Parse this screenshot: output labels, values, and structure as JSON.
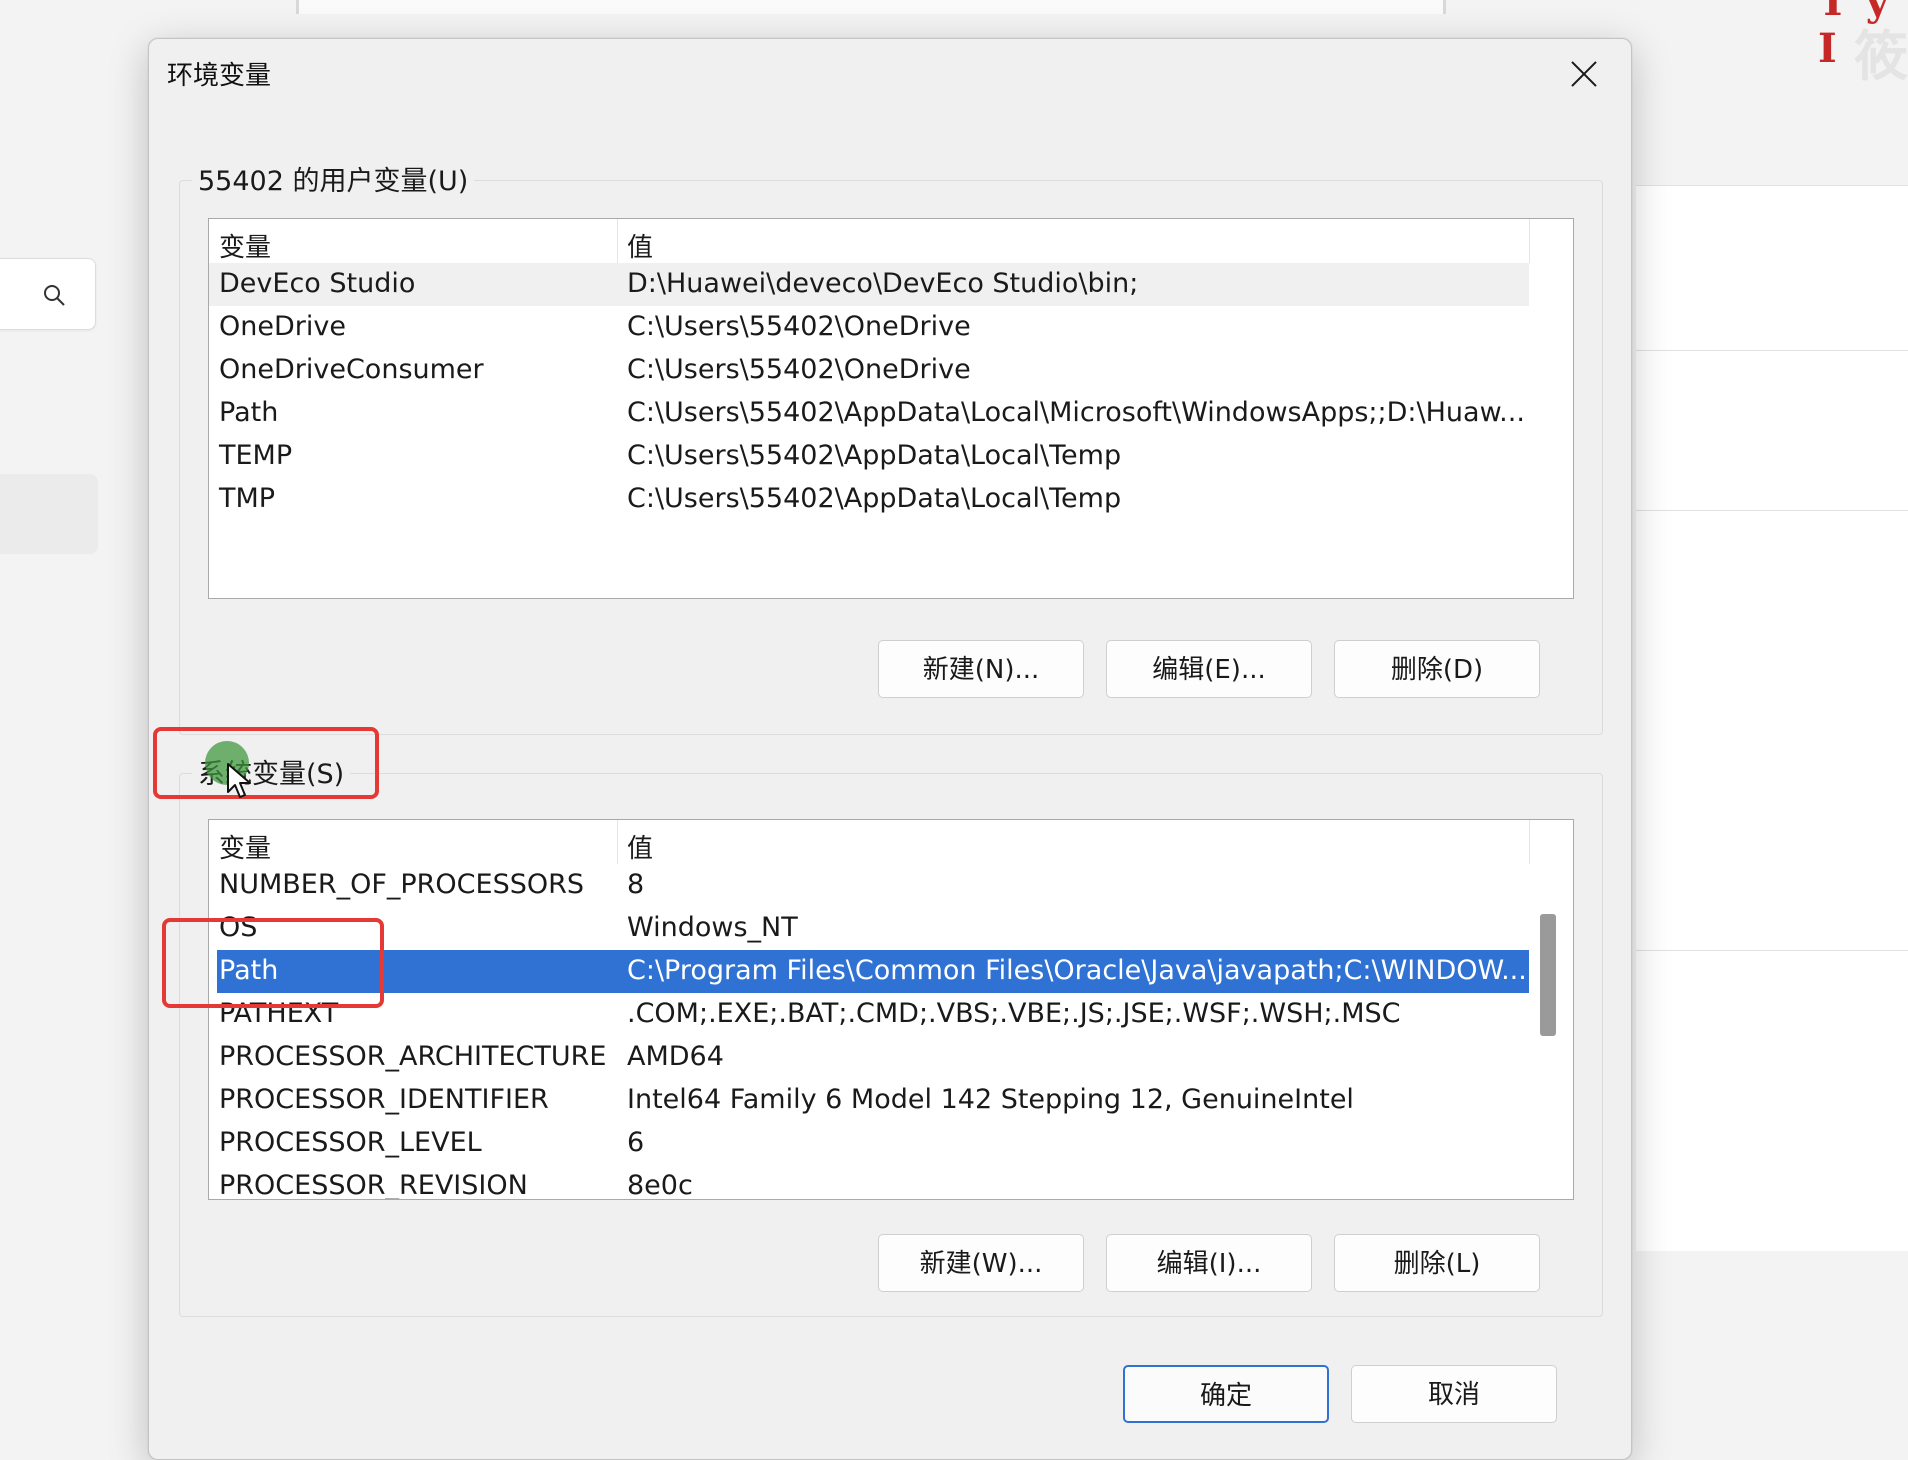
{
  "dialog": {
    "title": "环境变量",
    "user_section": {
      "legend": "55402 的用户变量(U)",
      "columns": [
        "变量",
        "值"
      ],
      "rows": [
        {
          "name": "DevEco Studio",
          "value": "D:\\Huawei\\deveco\\DevEco Studio\\bin;"
        },
        {
          "name": "OneDrive",
          "value": "C:\\Users\\55402\\OneDrive"
        },
        {
          "name": "OneDriveConsumer",
          "value": "C:\\Users\\55402\\OneDrive"
        },
        {
          "name": "Path",
          "value": "C:\\Users\\55402\\AppData\\Local\\Microsoft\\WindowsApps;;D:\\Huaw..."
        },
        {
          "name": "TEMP",
          "value": "C:\\Users\\55402\\AppData\\Local\\Temp"
        },
        {
          "name": "TMP",
          "value": "C:\\Users\\55402\\AppData\\Local\\Temp"
        }
      ],
      "buttons": {
        "new": "新建(N)...",
        "edit": "编辑(E)...",
        "delete": "删除(D)"
      }
    },
    "system_section": {
      "legend": "系统变量(S)",
      "columns": [
        "变量",
        "值"
      ],
      "rows": [
        {
          "name": "NUMBER_OF_PROCESSORS",
          "value": "8"
        },
        {
          "name": "OS",
          "value": "Windows_NT"
        },
        {
          "name": "Path",
          "value": "C:\\Program Files\\Common Files\\Oracle\\Java\\javapath;C:\\WINDOW..."
        },
        {
          "name": "PATHEXT",
          "value": ".COM;.EXE;.BAT;.CMD;.VBS;.VBE;.JS;.JSE;.WSF;.WSH;.MSC"
        },
        {
          "name": "PROCESSOR_ARCHITECTURE",
          "value": "AMD64"
        },
        {
          "name": "PROCESSOR_IDENTIFIER",
          "value": "Intel64 Family 6 Model 142 Stepping 12, GenuineIntel"
        },
        {
          "name": "PROCESSOR_LEVEL",
          "value": "6"
        },
        {
          "name": "PROCESSOR_REVISION",
          "value": "8e0c"
        }
      ],
      "selected_row": "Path",
      "buttons": {
        "new": "新建(W)...",
        "edit": "编辑(I)...",
        "delete": "删除(L)"
      }
    },
    "footer": {
      "ok": "确定",
      "cancel": "取消"
    }
  },
  "colors": {
    "selection": "#2f72d3",
    "highlight_box": "#e53935",
    "dialog_bg": "#f0f0f0"
  },
  "icons": {
    "search": "search-icon",
    "close": "close-icon",
    "cursor": "mouse-cursor-icon"
  }
}
